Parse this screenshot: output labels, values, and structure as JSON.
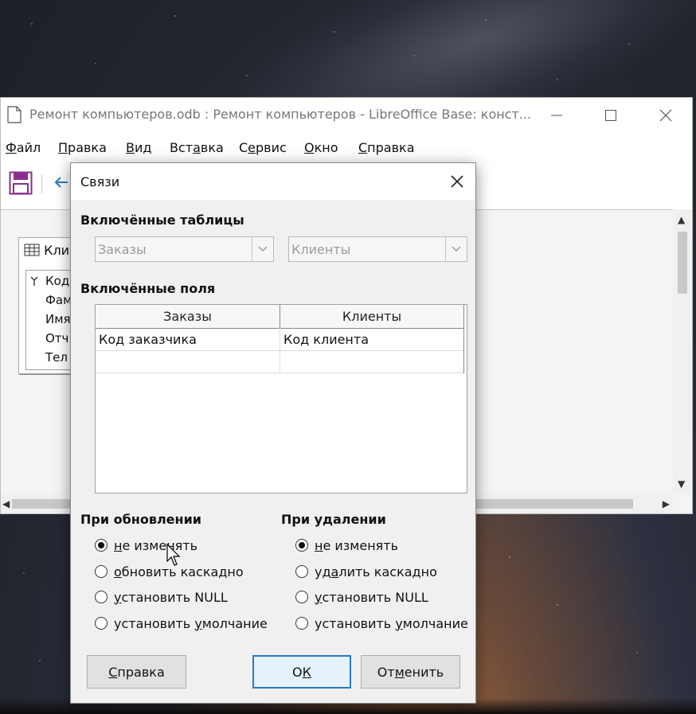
{
  "app": {
    "title": "Ремонт компьютеров.odb : Ремонт компьютеров - LibreOffice Base: конст...",
    "menu": [
      {
        "pre": "",
        "ul": "Ф",
        "post": "айл"
      },
      {
        "pre": "",
        "ul": "П",
        "post": "равка"
      },
      {
        "pre": "",
        "ul": "В",
        "post": "ид"
      },
      {
        "pre": "Вст",
        "ul": "а",
        "post": "вка"
      },
      {
        "pre": "С",
        "ul": "е",
        "post": "рвис"
      },
      {
        "pre": "",
        "ul": "О",
        "post": "кно"
      },
      {
        "pre": "",
        "ul": "С",
        "post": "правка"
      }
    ],
    "table_window": {
      "title_visible": "Кли",
      "fields_visible": [
        "Код",
        "Фам",
        "Имя",
        "Отч",
        "Тел"
      ]
    }
  },
  "dialog": {
    "title": "Связи",
    "included_tables_label": "Включённые таблицы",
    "table_left": "Заказы",
    "table_right": "Клиенты",
    "included_fields_label": "Включённые поля",
    "grid": {
      "headers": [
        "Заказы",
        "Клиенты"
      ],
      "rows": [
        [
          "Код заказчика",
          "Код клиента"
        ],
        [
          "",
          ""
        ]
      ]
    },
    "on_update": {
      "label": "При обновлении",
      "options": [
        {
          "pre": "",
          "ul": "н",
          "post": "е изменять",
          "checked": true
        },
        {
          "pre": "",
          "ul": "о",
          "post": "бновить каскадно",
          "checked": false
        },
        {
          "pre": "",
          "ul": "у",
          "post": "становить NULL",
          "checked": false
        },
        {
          "pre": "установить ",
          "ul": "у",
          "post": "молчание",
          "checked": false
        }
      ]
    },
    "on_delete": {
      "label": "При удалении",
      "options": [
        {
          "pre": "",
          "ul": "н",
          "post": "е изменять",
          "checked": true
        },
        {
          "pre": "уд",
          "ul": "а",
          "post": "лить каскадно",
          "checked": false
        },
        {
          "pre": "",
          "ul": "у",
          "post": "становить NULL",
          "checked": false
        },
        {
          "pre": "установить ",
          "ul": "у",
          "post": "молчание",
          "checked": false
        }
      ]
    },
    "buttons": {
      "help": {
        "pre": "",
        "ul": "С",
        "post": "правка"
      },
      "ok": {
        "pre": "О",
        "ul": "К",
        "post": ""
      },
      "cancel": {
        "pre": "От",
        "ul": "м",
        "post": "енить"
      }
    }
  },
  "colors": {
    "accent": "#2b79c9",
    "save_icon": "#8b2f8e"
  }
}
